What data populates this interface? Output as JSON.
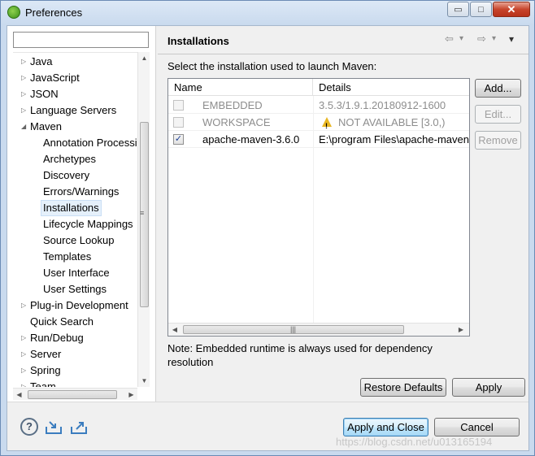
{
  "window": {
    "title": "Preferences",
    "controls": {
      "minimize": "▭",
      "maximize": "□",
      "close": "✕"
    }
  },
  "sidebar": {
    "filter_value": "",
    "tree": [
      {
        "label": "Java",
        "expandable": true,
        "level": 0
      },
      {
        "label": "JavaScript",
        "expandable": true,
        "level": 0
      },
      {
        "label": "JSON",
        "expandable": true,
        "level": 0
      },
      {
        "label": "Language Servers",
        "expandable": true,
        "level": 0
      },
      {
        "label": "Maven",
        "expanded": true,
        "level": 0
      },
      {
        "label": "Annotation Processing",
        "level": 1
      },
      {
        "label": "Archetypes",
        "level": 1
      },
      {
        "label": "Discovery",
        "level": 1
      },
      {
        "label": "Errors/Warnings",
        "level": 1
      },
      {
        "label": "Installations",
        "level": 1,
        "selected": true
      },
      {
        "label": "Lifecycle Mappings",
        "level": 1
      },
      {
        "label": "Source Lookup",
        "level": 1
      },
      {
        "label": "Templates",
        "level": 1
      },
      {
        "label": "User Interface",
        "level": 1
      },
      {
        "label": "User Settings",
        "level": 1
      },
      {
        "label": "Plug-in Development",
        "expandable": true,
        "level": 0
      },
      {
        "label": "Quick Search",
        "level": 0
      },
      {
        "label": "Run/Debug",
        "expandable": true,
        "level": 0
      },
      {
        "label": "Server",
        "expandable": true,
        "level": 0
      },
      {
        "label": "Spring",
        "expandable": true,
        "level": 0
      },
      {
        "label": "Team",
        "expandable": true,
        "level": 0
      }
    ]
  },
  "page": {
    "title": "Installations",
    "nav": {
      "back": "⇦",
      "forward": "⇨",
      "menu": "▾"
    },
    "description": "Select the installation used to launch Maven:",
    "table": {
      "columns": [
        "Name",
        "Details"
      ],
      "rows": [
        {
          "name": "EMBEDDED",
          "details": "3.5.3/1.9.1.20180912-1600",
          "checked": false,
          "disabled": true,
          "warning": false
        },
        {
          "name": "WORKSPACE",
          "details": "NOT AVAILABLE [3.0,)",
          "checked": false,
          "disabled": true,
          "warning": true
        },
        {
          "name": "apache-maven-3.6.0",
          "details": "E:\\program Files\\apache-maven",
          "checked": true,
          "disabled": false,
          "warning": false
        }
      ]
    },
    "buttons": {
      "add": "Add...",
      "edit": "Edit...",
      "remove": "Remove"
    },
    "note": "Note: Embedded runtime is always used for dependency resolution",
    "restore_defaults": "Restore Defaults",
    "apply": "Apply"
  },
  "footer": {
    "help_icon": "?",
    "apply_and_close": "Apply and Close",
    "cancel": "Cancel",
    "watermark": "https://blog.csdn.net/u013165194"
  }
}
